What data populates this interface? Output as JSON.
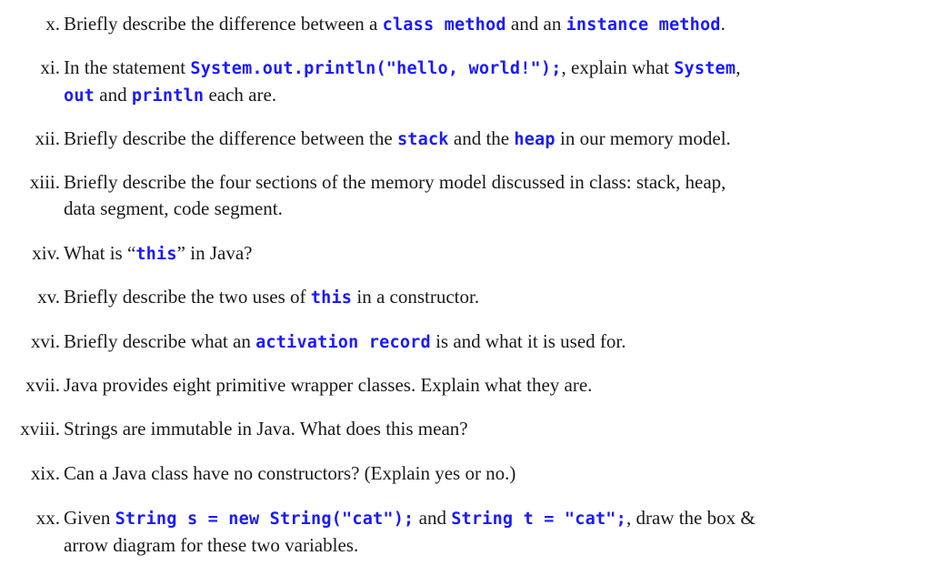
{
  "code_color": "#1a1aff",
  "items": [
    {
      "num": "x.",
      "parts": [
        {
          "t": "Briefly describe the difference between a "
        },
        {
          "c": "class method"
        },
        {
          "t": " and an "
        },
        {
          "c": "instance method"
        },
        {
          "t": "."
        }
      ]
    },
    {
      "num": "xi.",
      "parts": [
        {
          "t": "In the statement "
        },
        {
          "c": "System.out.println(\"hello, world!\");"
        },
        {
          "t": ", explain what "
        },
        {
          "c": "System"
        },
        {
          "t": ", "
        },
        {
          "br": true
        },
        {
          "c": "out"
        },
        {
          "t": " and "
        },
        {
          "c": "println"
        },
        {
          "t": " each are."
        }
      ]
    },
    {
      "num": "xii.",
      "parts": [
        {
          "t": "Briefly describe the difference between the "
        },
        {
          "c": "stack"
        },
        {
          "t": " and the "
        },
        {
          "c": "heap"
        },
        {
          "t": " in our memory model."
        }
      ]
    },
    {
      "num": "xiii.",
      "parts": [
        {
          "t": "Briefly describe the four sections of the memory model discussed in class: stack, heap,"
        },
        {
          "br": true
        },
        {
          "t": "data segment, code segment."
        }
      ]
    },
    {
      "num": "xiv.",
      "parts": [
        {
          "t": "What is “"
        },
        {
          "c": "this"
        },
        {
          "t": "” in Java?"
        }
      ]
    },
    {
      "num": "xv.",
      "parts": [
        {
          "t": "Briefly describe the two uses of "
        },
        {
          "c": "this"
        },
        {
          "t": " in a constructor."
        }
      ]
    },
    {
      "num": "xvi.",
      "parts": [
        {
          "t": "Briefly describe what an "
        },
        {
          "c": "activation record"
        },
        {
          "t": " is and what it is used for."
        }
      ]
    },
    {
      "num": "xvii.",
      "parts": [
        {
          "t": "Java provides eight primitive wrapper classes. Explain what they are."
        }
      ]
    },
    {
      "num": "xviii.",
      "parts": [
        {
          "t": "Strings are immutable in Java. What does this mean?"
        }
      ]
    },
    {
      "num": "xix.",
      "parts": [
        {
          "t": "Can a Java class have no constructors? (Explain yes or no.)"
        }
      ]
    },
    {
      "num": "xx.",
      "parts": [
        {
          "t": "Given "
        },
        {
          "c": "String s = new String(\"cat\");"
        },
        {
          "t": " and "
        },
        {
          "c": "String t = \"cat\";"
        },
        {
          "t": ", draw the box &"
        },
        {
          "br": true
        },
        {
          "t": "arrow diagram for these two variables."
        }
      ]
    }
  ]
}
